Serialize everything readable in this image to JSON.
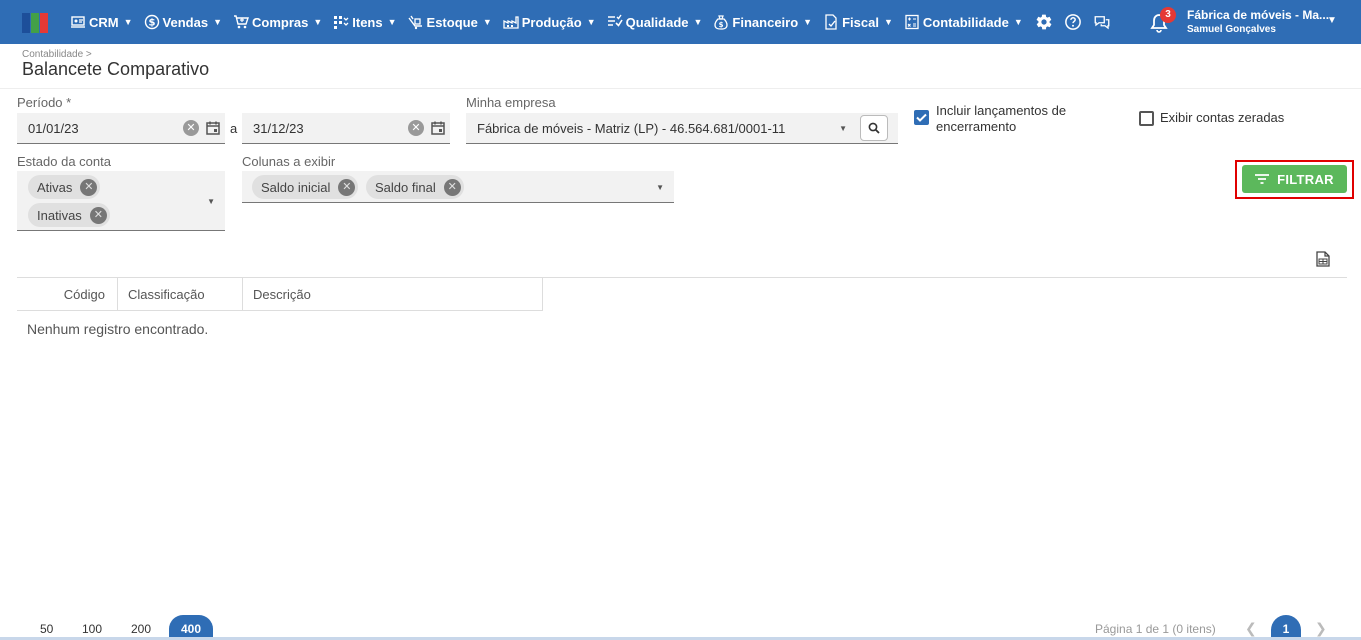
{
  "nav": {
    "items": [
      {
        "label": "CRM",
        "icon": "crm-icon"
      },
      {
        "label": "Vendas",
        "icon": "dollar-icon"
      },
      {
        "label": "Compras",
        "icon": "cart-icon"
      },
      {
        "label": "Itens",
        "icon": "items-icon"
      },
      {
        "label": "Estoque",
        "icon": "stock-icon"
      },
      {
        "label": "Produção",
        "icon": "factory-icon"
      },
      {
        "label": "Qualidade",
        "icon": "quality-icon"
      },
      {
        "label": "Financeiro",
        "icon": "moneybag-icon"
      },
      {
        "label": "Fiscal",
        "icon": "fiscal-icon"
      },
      {
        "label": "Contabilidade",
        "icon": "calculator-icon"
      }
    ],
    "notification_count": "3",
    "company_name": "Fábrica de móveis - Ma...",
    "user_name": "Samuel Gonçalves"
  },
  "header": {
    "breadcrumb": "Contabilidade >",
    "title": "Balancete Comparativo"
  },
  "form": {
    "period_label": "Período *",
    "date_from": "01/01/23",
    "date_separator": "a",
    "date_to": "31/12/23",
    "company_label": "Minha empresa",
    "company_value": "Fábrica de móveis - Matriz (LP) - 46.564.681/0001-11",
    "include_closing_label_1": "Incluir lançamentos de",
    "include_closing_label_2": "encerramento",
    "include_closing_checked": true,
    "show_zero_label": "Exibir contas zeradas",
    "show_zero_checked": false,
    "account_state_label": "Estado da conta",
    "account_state_chips": [
      "Ativas",
      "Inativas"
    ],
    "columns_label": "Colunas a exibir",
    "columns_chips": [
      "Saldo inicial",
      "Saldo final"
    ],
    "filter_button": "FILTRAR"
  },
  "table": {
    "columns": [
      "Código",
      "Classificação",
      "Descrição"
    ],
    "empty_message": "Nenhum registro encontrado."
  },
  "footer": {
    "page_sizes": [
      "50",
      "100",
      "200",
      "400"
    ],
    "active_page_size": "400",
    "page_info": "Página 1 de 1 (0 itens)",
    "current_page": "1"
  },
  "colors": {
    "primary": "#2f6db5",
    "filter_green": "#5cb85c",
    "highlight_red": "#e00000",
    "badge_red": "#e53935"
  }
}
